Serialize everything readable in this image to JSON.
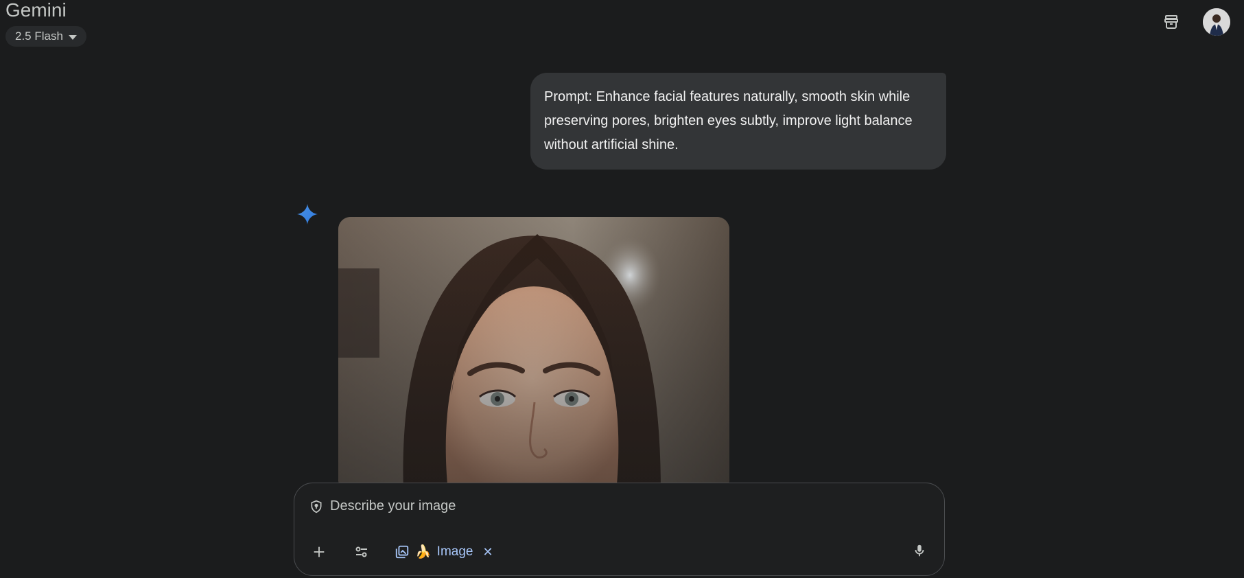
{
  "app": {
    "title": "Gemini",
    "model": "2.5 Flash"
  },
  "header": {
    "icons": [
      "archive-icon",
      "avatar"
    ]
  },
  "conversation": {
    "user_prompt": "Prompt: Enhance facial features naturally, smooth skin while preserving pores, brighten eyes subtly, improve light balance without artificial shine.",
    "response": {
      "icon": "gemini-sparkle-icon",
      "image_type": "portrait photo of a woman with long brown hair"
    }
  },
  "composer": {
    "placeholder": "Describe your image",
    "tools": [
      "add-icon",
      "tools-icon"
    ],
    "active_tool": {
      "emoji": "🍌",
      "label": "Image"
    },
    "mic_icon": "microphone-icon"
  },
  "colors": {
    "background": "#1b1c1d",
    "bubble": "#333537",
    "accent": "#a8c7fa",
    "sparkle": "#4a90e2"
  }
}
